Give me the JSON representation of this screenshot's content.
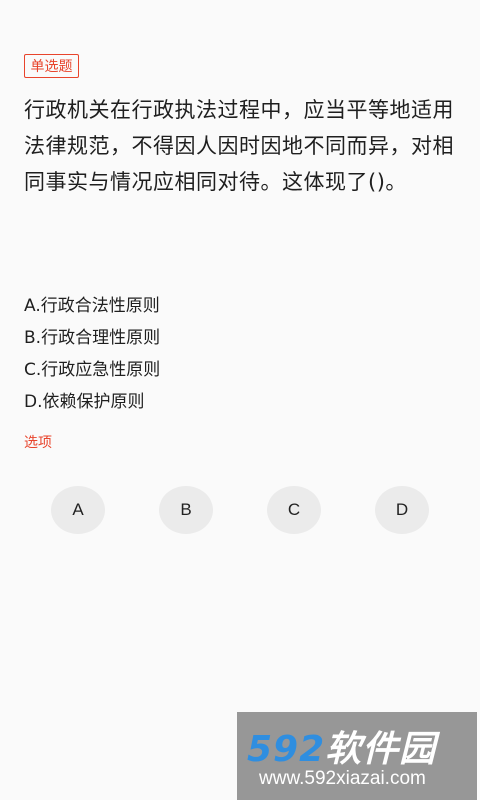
{
  "question": {
    "type_tag": "单选题",
    "text": "行政机关在行政执法过程中，应当平等地适用法律规范，不得因人因时因地不同而异，对相同事实与情况应相同对待。这体现了()。"
  },
  "options": [
    "A.行政合法性原则",
    "B.行政合理性原则",
    "C.行政应急性原则",
    "D.依赖保护原则"
  ],
  "section_label": "选项",
  "choices": [
    "A",
    "B",
    "C",
    "D"
  ],
  "watermark": {
    "number": "592",
    "name": "软件园",
    "url": "www.592xiazai.com"
  },
  "colors": {
    "accent": "#e8442c",
    "background": "#fafafa",
    "choice_bg": "#ebebeb"
  }
}
